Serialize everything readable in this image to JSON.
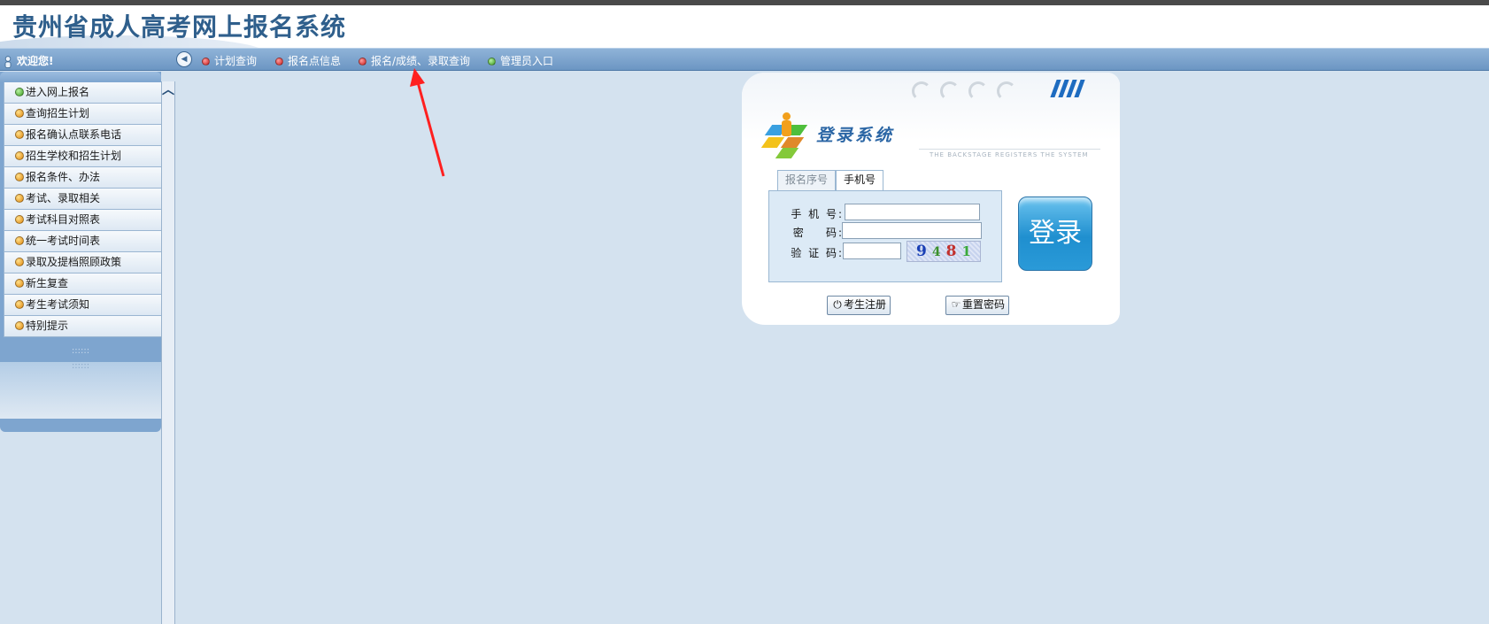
{
  "header": {
    "title": "贵州省成人高考网上报名系统"
  },
  "navbar": {
    "welcome": "欢迎您!",
    "items": [
      {
        "label": "计划查询",
        "dot": "red"
      },
      {
        "label": "报名点信息",
        "dot": "red"
      },
      {
        "label": "报名/成绩、录取查询",
        "dot": "red"
      },
      {
        "label": "管理员入口",
        "dot": "green"
      }
    ]
  },
  "sidebar": {
    "items": [
      {
        "label": "进入网上报名",
        "dot": "green"
      },
      {
        "label": "查询招生计划",
        "dot": "orange"
      },
      {
        "label": "报名确认点联系电话",
        "dot": "orange"
      },
      {
        "label": "招生学校和招生计划",
        "dot": "orange"
      },
      {
        "label": "报名条件、办法",
        "dot": "orange"
      },
      {
        "label": "考试、录取相关",
        "dot": "orange"
      },
      {
        "label": "考试科目对照表",
        "dot": "orange"
      },
      {
        "label": "统一考试时间表",
        "dot": "orange"
      },
      {
        "label": "录取及提档照顾政策",
        "dot": "orange"
      },
      {
        "label": "新生复查",
        "dot": "orange"
      },
      {
        "label": "考生考试须知",
        "dot": "orange"
      },
      {
        "label": "特别提示",
        "dot": "orange"
      }
    ],
    "grip": "::::::"
  },
  "login": {
    "title": "登录系统",
    "tagline": "THE BACKSTAGE REGISTERS THE SYSTEM",
    "tabs": [
      {
        "label": "报名序号",
        "active": false
      },
      {
        "label": "手机号",
        "active": true
      }
    ],
    "fields": {
      "phone_label": "手 机 号:",
      "phone_value": "",
      "password_label": "密    码:",
      "password_value": "",
      "captcha_label": "验 证 码:",
      "captcha_value": ""
    },
    "captcha_chars": [
      "9",
      "4",
      "8",
      "1"
    ],
    "login_button": "登录",
    "register_button": "考生注册",
    "reset_button": "重置密码"
  },
  "colors": {
    "background": "#d4e2ef",
    "navbar": "#7ea5cf",
    "title": "#2f5f8c",
    "annotation_arrow": "#ff2020"
  }
}
